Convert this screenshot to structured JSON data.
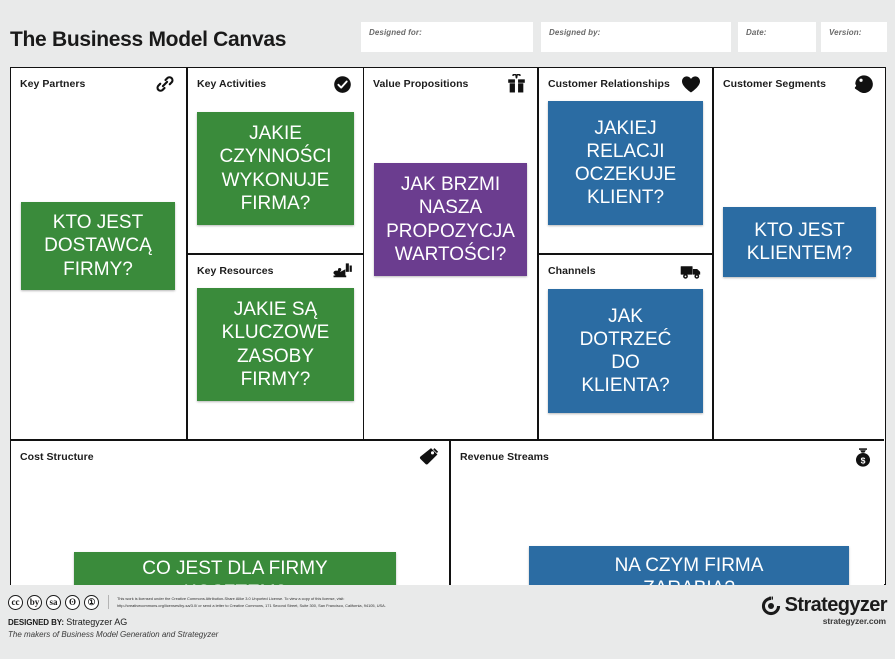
{
  "header": {
    "title": "The Business Model Canvas",
    "fields": [
      {
        "label": "Designed for:",
        "value": ""
      },
      {
        "label": "Designed by:",
        "value": ""
      },
      {
        "label": "Date:",
        "value": ""
      },
      {
        "label": "Version:",
        "value": ""
      }
    ]
  },
  "colors": {
    "green": "#3a8b3b",
    "blue": "#2b6ca3",
    "purple": "#6b3d8f",
    "page_background": "#e9eaea",
    "border": "#121212"
  },
  "blocks": {
    "key_partners": {
      "title": "Key Partners",
      "icon": "chain-link-icon",
      "note": {
        "text": "KTO JEST\nDOSTAWCĄ\nFIRMY?",
        "color": "green"
      }
    },
    "key_activities": {
      "title": "Key Activities",
      "icon": "check-circle-icon",
      "note": {
        "text": "JAKIE\nCZYNNOŚCI\nWYKONUJE\nFIRMA?",
        "color": "green"
      }
    },
    "key_resources": {
      "title": "Key Resources",
      "icon": "factory-icon",
      "note": {
        "text": "JAKIE SĄ\nKLUCZOWE\nZASOBY\nFIRMY?",
        "color": "green"
      }
    },
    "value_propositions": {
      "title": "Value Propositions",
      "icon": "gift-icon",
      "note": {
        "text": "JAK BRZMI\nNASZA\nPROPOZYCJA\nWARTOŚCI?",
        "color": "purple"
      }
    },
    "customer_relationships": {
      "title": "Customer Relationships",
      "icon": "heart-icon",
      "note": {
        "text": "JAKIEJ\nRELACJI\nOCZEKUJE\nKLIENT?",
        "color": "blue"
      }
    },
    "channels": {
      "title": "Channels",
      "icon": "delivery-truck-icon",
      "note": {
        "text": "JAK\nDOTRZEĆ\nDO\nKLIENTA?",
        "color": "blue"
      }
    },
    "customer_segments": {
      "title": "Customer Segments",
      "icon": "head-profile-icon",
      "note": {
        "text": "KTO JEST\nKLIENTEM?",
        "color": "blue"
      }
    },
    "cost_structure": {
      "title": "Cost Structure",
      "icon": "price-tag-icon",
      "note": {
        "text": "CO JEST DLA FIRMY\nKOSZTEM?",
        "color": "green"
      }
    },
    "revenue_streams": {
      "title": "Revenue Streams",
      "icon": "money-bag-icon",
      "note": {
        "text": "NA CZYM FIRMA\nZARABIA?",
        "color": "blue"
      }
    }
  },
  "footer": {
    "license_text": "This work is licensed under the Creative Commons Attribution-Share Alike 3.0 Unported License. To view a copy of this license, visit: http://creativecommons.org/licenses/by-sa/3.0/ or send a letter to Creative Commons, 171 Second Street, Suite 300, San Francisco, California, 94105, USA.",
    "cc_badges": [
      "cc",
      "by",
      "sa",
      "ʘ",
      "①"
    ],
    "designed_by_label": "DESIGNED BY:",
    "designed_by_value": "Strategyzer AG",
    "makers_line": "The makers of Business Model Generation and Strategyzer",
    "brand_name": "Strategyzer",
    "brand_url": "strategyzer.com"
  }
}
